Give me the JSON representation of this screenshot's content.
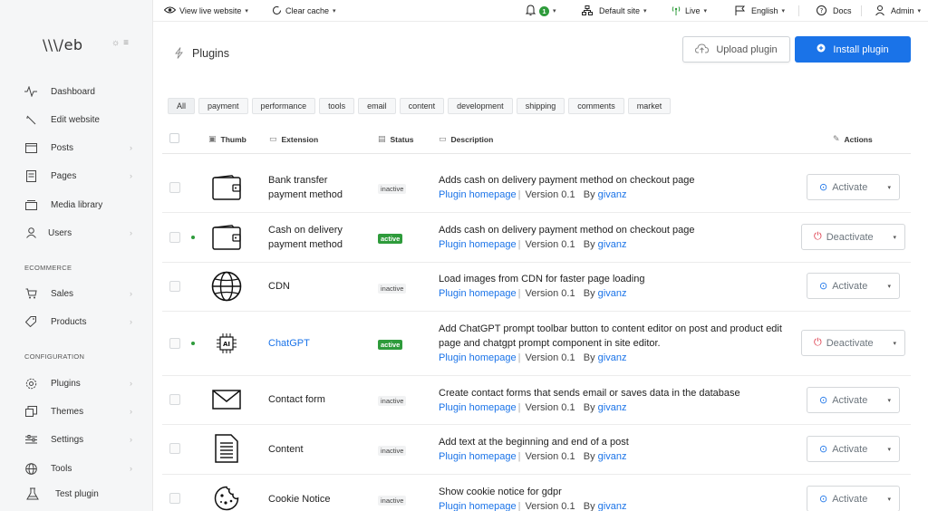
{
  "brand": {
    "logo": "\\\\\\/eb"
  },
  "topbar": {
    "view_live": "View live website",
    "clear_cache": "Clear cache",
    "notifications_count": "1",
    "default_site": "Default site",
    "live": "Live",
    "language": "English",
    "docs": "Docs",
    "user": "Admin"
  },
  "sidebar": {
    "items": [
      {
        "label": "Dashboard",
        "icon": "pulse-icon",
        "chevron": false
      },
      {
        "label": "Edit website",
        "icon": "wand-icon",
        "chevron": false
      },
      {
        "label": "Posts",
        "icon": "posts-icon",
        "chevron": true
      },
      {
        "label": "Pages",
        "icon": "pages-icon",
        "chevron": true
      },
      {
        "label": "Media library",
        "icon": "media-icon",
        "chevron": false
      },
      {
        "label": "Users",
        "icon": "user-icon",
        "chevron": true
      }
    ],
    "section_ecommerce": "ECOMMERCE",
    "ecommerce_items": [
      {
        "label": "Sales",
        "icon": "cart-icon",
        "chevron": true
      },
      {
        "label": "Products",
        "icon": "tag-icon",
        "chevron": true
      }
    ],
    "section_configuration": "CONFIGURATION",
    "configuration_items": [
      {
        "label": "Plugins",
        "icon": "gear-icon",
        "chevron": true
      },
      {
        "label": "Themes",
        "icon": "themes-icon",
        "chevron": true
      },
      {
        "label": "Settings",
        "icon": "sliders-icon",
        "chevron": true
      },
      {
        "label": "Tools",
        "icon": "globe-icon",
        "chevron": true
      },
      {
        "label": "Test plugin",
        "icon": "flask-icon",
        "chevron": false
      }
    ]
  },
  "header": {
    "title": "Plugins",
    "upload_label": "Upload plugin",
    "install_label": "Install plugin"
  },
  "filters": [
    "All",
    "payment",
    "performance",
    "tools",
    "email",
    "content",
    "development",
    "shipping",
    "comments",
    "market"
  ],
  "table": {
    "headers": {
      "thumb": "Thumb",
      "extension": "Extension",
      "status": "Status",
      "description": "Description",
      "actions": "Actions"
    },
    "rows": [
      {
        "name_line1": "Bank transfer",
        "name_line2": "payment method",
        "status": "inactive",
        "active": false,
        "desc": "Adds cash on delivery payment method on checkout page",
        "homepage": "Plugin homepage",
        "version": "Version 0.1",
        "by": "By",
        "author": "givanz",
        "action": "Activate",
        "icon": "wallet-icon"
      },
      {
        "name_line1": "Cash on delivery",
        "name_line2": "payment method",
        "status": "active",
        "active": true,
        "desc": "Adds cash on delivery payment method on checkout page",
        "homepage": "Plugin homepage",
        "version": "Version 0.1",
        "by": "By",
        "author": "givanz",
        "action": "Deactivate",
        "icon": "wallet-icon"
      },
      {
        "name_line1": "CDN",
        "name_line2": "",
        "status": "inactive",
        "active": false,
        "desc": "Load images from CDN for faster page loading",
        "homepage": "Plugin homepage",
        "version": "Version 0.1",
        "by": "By",
        "author": "givanz",
        "action": "Activate",
        "icon": "globe-icon"
      },
      {
        "name_line1": "ChatGPT",
        "name_line2": "",
        "status": "active",
        "active": true,
        "desc": "Add ChatGPT prompt toolbar button to content editor on post and product edit page and chatgpt prompt component in site editor.",
        "homepage": "Plugin homepage",
        "version": "Version 0.1",
        "by": "By",
        "author": "givanz",
        "action": "Deactivate",
        "icon": "ai-chip-icon"
      },
      {
        "name_line1": "Contact form",
        "name_line2": "",
        "status": "inactive",
        "active": false,
        "desc": "Create contact forms that sends email or saves data in the database",
        "homepage": "Plugin homepage",
        "version": "Version 0.1",
        "by": "By",
        "author": "givanz",
        "action": "Activate",
        "icon": "envelope-icon"
      },
      {
        "name_line1": "Content",
        "name_line2": "",
        "status": "inactive",
        "active": false,
        "desc": "Add text at the beginning and end of a post",
        "homepage": "Plugin homepage",
        "version": "Version 0.1",
        "by": "By",
        "author": "givanz",
        "action": "Activate",
        "icon": "document-icon"
      },
      {
        "name_line1": "Cookie Notice",
        "name_line2": "",
        "status": "inactive",
        "active": false,
        "desc": "Show cookie notice for gdpr",
        "homepage": "Plugin homepage",
        "version": "Version 0.1",
        "by": "By",
        "author": "givanz",
        "action": "Activate",
        "icon": "cookie-icon"
      }
    ]
  },
  "colors": {
    "accent": "#1a73e8",
    "active": "#2e9b3b",
    "danger": "#dc3545"
  }
}
